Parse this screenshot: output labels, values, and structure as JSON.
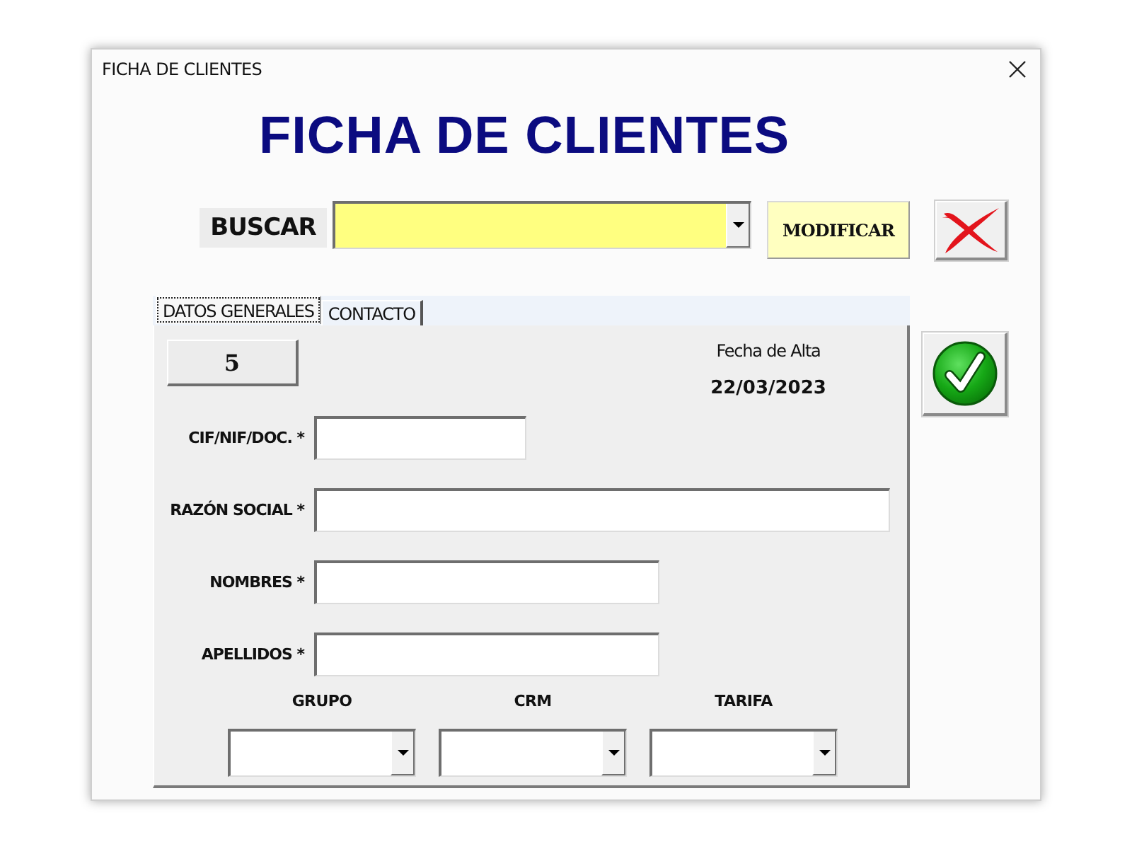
{
  "window": {
    "title": "FICHA DE CLIENTES"
  },
  "heading": "FICHA DE CLIENTES",
  "search": {
    "label": "BUSCAR",
    "button": "MODIFICAR"
  },
  "tabs": [
    {
      "label": "DATOS GENERALES",
      "selected": true
    },
    {
      "label": "CONTACTO",
      "selected": false
    }
  ],
  "record": {
    "number": "5",
    "date_label": "Fecha de Alta",
    "date": "22/03/2023"
  },
  "fields": [
    {
      "label": "CIF/NIF/DOC. *"
    },
    {
      "label": "RAZÓN SOCIAL *"
    },
    {
      "label": "NOMBRES *"
    },
    {
      "label": "APELLIDOS *"
    }
  ],
  "dropdowns": [
    {
      "label": "GRUPO"
    },
    {
      "label": "CRM"
    },
    {
      "label": "TARIFA"
    }
  ]
}
